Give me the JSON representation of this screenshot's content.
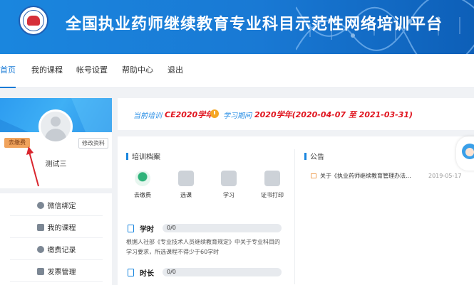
{
  "header": {
    "title": "全国执业药师继续教育专业科目示范性网络培训平台",
    "logo_icon": "organization-seal-logo"
  },
  "nav": {
    "items": [
      {
        "label": "首页",
        "active": true
      },
      {
        "label": "我的课程",
        "active": false
      },
      {
        "label": "帐号设置",
        "active": false
      },
      {
        "label": "帮助中心",
        "active": false
      },
      {
        "label": "退出",
        "active": false
      }
    ]
  },
  "profile": {
    "pay_badge": "去缴费",
    "edit_button": "修改资料",
    "name": "测试三"
  },
  "sidebar": {
    "items": [
      {
        "label": "微信绑定",
        "icon": "wechat-icon"
      },
      {
        "label": "我的课程",
        "icon": "book-icon"
      },
      {
        "label": "缴费记录",
        "icon": "payment-record-icon"
      },
      {
        "label": "发票管理",
        "icon": "invoice-icon"
      }
    ]
  },
  "training_info": {
    "current_label": "当前培训",
    "current_value": "CE2020学年",
    "period_label": "学习期间",
    "period_value": "2020学年(2020-04-07 至 2021-03-31)"
  },
  "records": {
    "title": "培训档案",
    "steps": [
      {
        "label": "去缴费",
        "icon": "pay-icon",
        "active": true
      },
      {
        "label": "选课",
        "icon": "select-course-icon",
        "active": false
      },
      {
        "label": "学习",
        "icon": "study-book-icon",
        "active": false
      },
      {
        "label": "证书打印",
        "icon": "printer-icon",
        "active": false
      }
    ],
    "hours": {
      "label": "学时",
      "value": "0/0",
      "progress": 0
    },
    "description": "根据人社部《专业技术人员继续教育规定》中关于专业科目的学习要求，所选课程不得少于60学时",
    "duration": {
      "label": "时长",
      "value": "0/0",
      "progress": 0
    }
  },
  "announcements": {
    "title": "公告",
    "items": [
      {
        "title": "关于《执业药师继续教育管理办法...",
        "date": "2019-05-17"
      }
    ]
  },
  "colors": {
    "brand_blue": "#1a86de",
    "highlight_red": "#e0141e",
    "badge_orange": "#f0a35c"
  }
}
